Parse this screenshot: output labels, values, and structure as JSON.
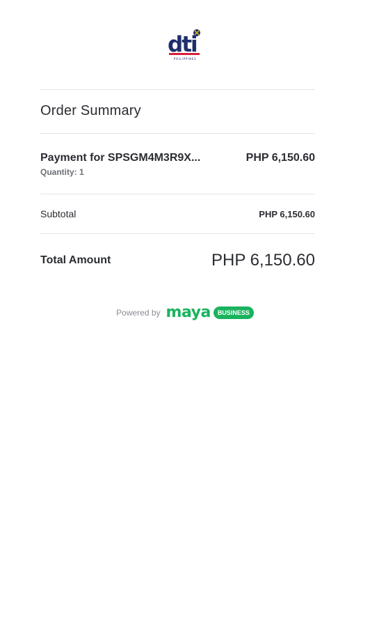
{
  "logo": {
    "brand": "dti",
    "caption": "PHILIPPINES"
  },
  "summary": {
    "title": "Order Summary",
    "item": {
      "name": "Payment for SPSGM4M3R9X...",
      "quantity": "Quantity: 1",
      "price": "PHP 6,150.60"
    },
    "subtotal_label": "Subtotal",
    "subtotal_value": "PHP 6,150.60",
    "total_label": "Total Amount",
    "total_value": "PHP 6,150.60"
  },
  "footer": {
    "powered_by": "Powered by",
    "maya": "maya",
    "business": "BUSINESS"
  },
  "colors": {
    "brand_green": "#19b35e",
    "dti_blue": "#1f2f6b",
    "dti_red": "#d6213a"
  }
}
